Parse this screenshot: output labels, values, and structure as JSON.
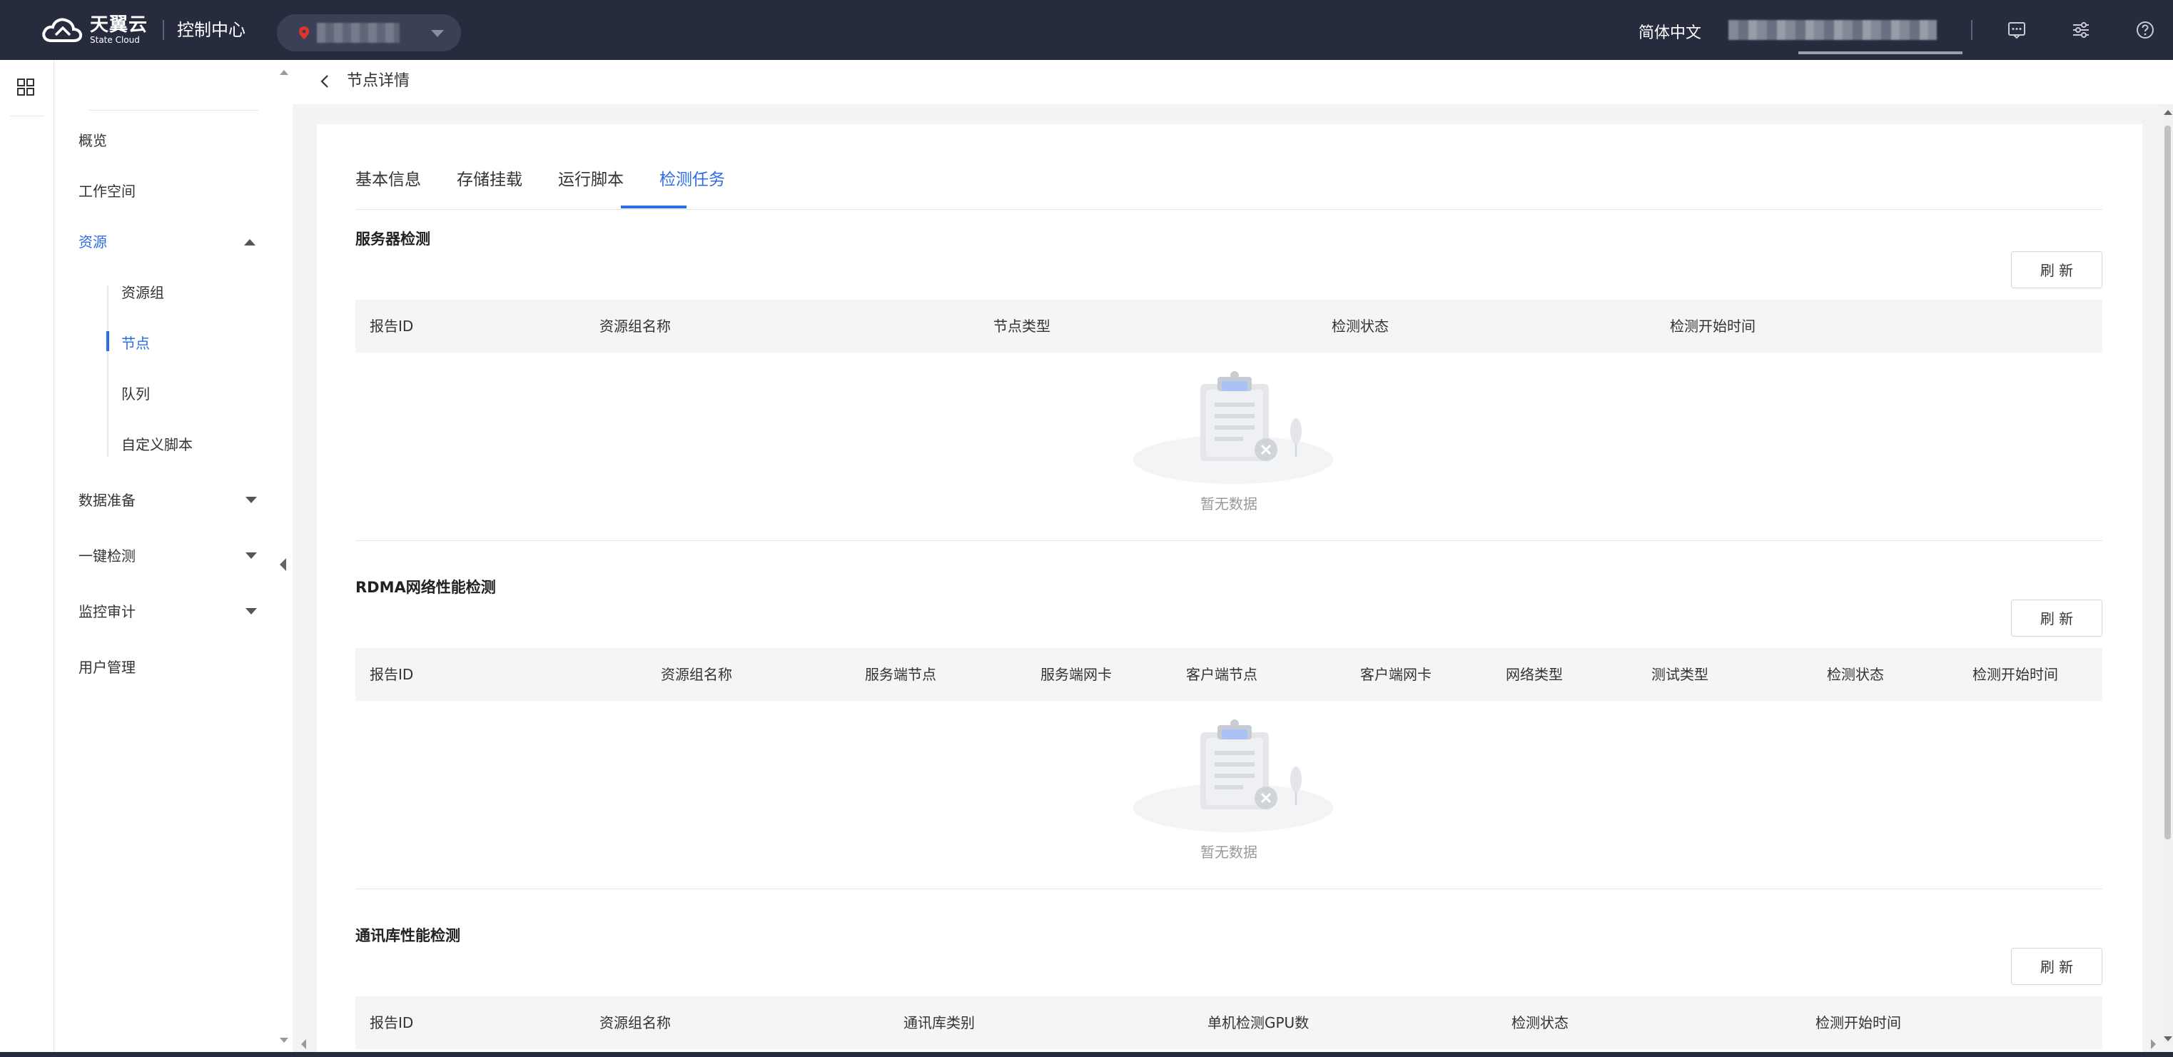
{
  "topbar": {
    "logo_cn": "天翼云",
    "logo_en": "State Cloud",
    "console_title": "控制中心",
    "language": "简体中文"
  },
  "sidebar": {
    "items": [
      {
        "label": "概览"
      },
      {
        "label": "工作空间"
      },
      {
        "label": "资源",
        "expanded": true,
        "active": true
      },
      {
        "label": "数据准备"
      },
      {
        "label": "一键检测"
      },
      {
        "label": "监控审计"
      },
      {
        "label": "用户管理"
      }
    ],
    "sub_items": [
      {
        "label": "资源组"
      },
      {
        "label": "节点",
        "active": true
      },
      {
        "label": "队列"
      },
      {
        "label": "自定义脚本"
      }
    ]
  },
  "header": {
    "title": "节点详情"
  },
  "tabs": [
    {
      "label": "基本信息"
    },
    {
      "label": "存储挂载"
    },
    {
      "label": "运行脚本"
    },
    {
      "label": "检测任务",
      "active": true
    }
  ],
  "sections": [
    {
      "title": "服务器检测",
      "refresh_label": "刷 新",
      "columns": [
        "报告ID",
        "资源组名称",
        "节点类型",
        "检测状态",
        "检测开始时间"
      ],
      "empty_text": "暂无数据"
    },
    {
      "title": "RDMA网络性能检测",
      "refresh_label": "刷 新",
      "columns": [
        "报告ID",
        "资源组名称",
        "服务端节点",
        "服务端网卡",
        "客户端节点",
        "客户端网卡",
        "网络类型",
        "测试类型",
        "检测状态",
        "检测开始时间"
      ],
      "empty_text": "暂无数据"
    },
    {
      "title": "通讯库性能检测",
      "refresh_label": "刷 新",
      "columns": [
        "报告ID",
        "资源组名称",
        "通讯库类别",
        "单机检测GPU数",
        "检测状态",
        "检测开始时间"
      ]
    }
  ],
  "colors": {
    "topbar_bg": "#262b3e",
    "accent": "#2e6be6",
    "page_bg": "#f2f3f5"
  },
  "icons": [
    "cloud-logo-icon",
    "location-pin-icon",
    "caret-down-icon",
    "message-icon",
    "settings-sliders-icon",
    "help-icon",
    "grid-apps-icon",
    "back-arrow-icon",
    "empty-clipboard-icon"
  ]
}
